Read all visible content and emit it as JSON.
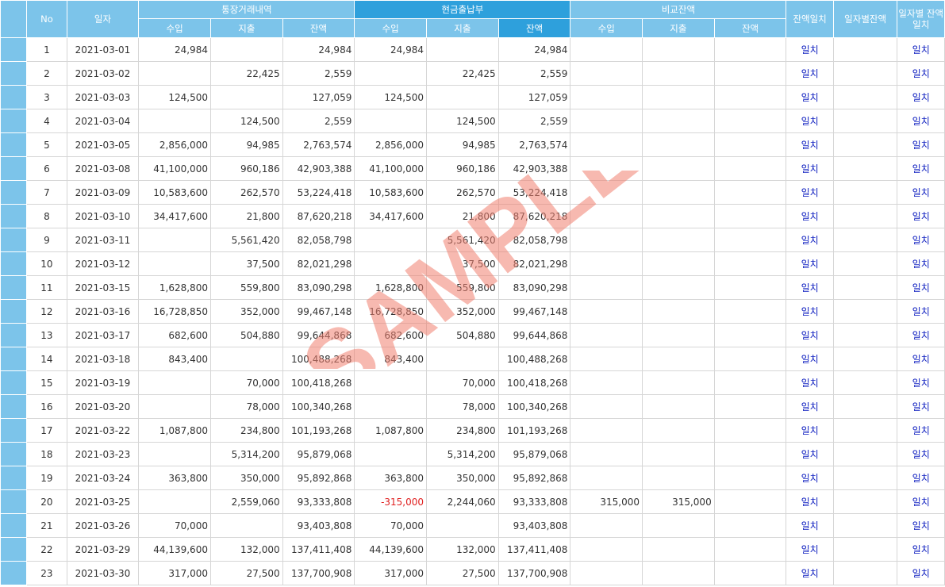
{
  "headers": {
    "no": "No",
    "date": "일자",
    "group_bank": "통장거래내역",
    "group_cash": "현금출납부",
    "group_diff": "비교잔액",
    "income": "수입",
    "expense": "지출",
    "balance": "잔액",
    "balance_match": "잔액일치",
    "daily_balance": "일자별잔액",
    "daily_match": "일자별 잔액일치"
  },
  "rows": [
    {
      "no": "1",
      "date": "2021-03-01",
      "b_in": "24,984",
      "b_out": "",
      "b_bal": "24,984",
      "c_in": "24,984",
      "c_out": "",
      "c_bal": "24,984",
      "d_in": "",
      "d_out": "",
      "d_bal": "",
      "match": "일치",
      "daily": "",
      "dmatch": "일치"
    },
    {
      "no": "2",
      "date": "2021-03-02",
      "b_in": "",
      "b_out": "22,425",
      "b_bal": "2,559",
      "c_in": "",
      "c_out": "22,425",
      "c_bal": "2,559",
      "d_in": "",
      "d_out": "",
      "d_bal": "",
      "match": "일치",
      "daily": "",
      "dmatch": "일치"
    },
    {
      "no": "3",
      "date": "2021-03-03",
      "b_in": "124,500",
      "b_out": "",
      "b_bal": "127,059",
      "c_in": "124,500",
      "c_out": "",
      "c_bal": "127,059",
      "d_in": "",
      "d_out": "",
      "d_bal": "",
      "match": "일치",
      "daily": "",
      "dmatch": "일치"
    },
    {
      "no": "4",
      "date": "2021-03-04",
      "b_in": "",
      "b_out": "124,500",
      "b_bal": "2,559",
      "c_in": "",
      "c_out": "124,500",
      "c_bal": "2,559",
      "d_in": "",
      "d_out": "",
      "d_bal": "",
      "match": "일치",
      "daily": "",
      "dmatch": "일치"
    },
    {
      "no": "5",
      "date": "2021-03-05",
      "b_in": "2,856,000",
      "b_out": "94,985",
      "b_bal": "2,763,574",
      "c_in": "2,856,000",
      "c_out": "94,985",
      "c_bal": "2,763,574",
      "d_in": "",
      "d_out": "",
      "d_bal": "",
      "match": "일치",
      "daily": "",
      "dmatch": "일치"
    },
    {
      "no": "6",
      "date": "2021-03-08",
      "b_in": "41,100,000",
      "b_out": "960,186",
      "b_bal": "42,903,388",
      "c_in": "41,100,000",
      "c_out": "960,186",
      "c_bal": "42,903,388",
      "d_in": "",
      "d_out": "",
      "d_bal": "",
      "match": "일치",
      "daily": "",
      "dmatch": "일치"
    },
    {
      "no": "7",
      "date": "2021-03-09",
      "b_in": "10,583,600",
      "b_out": "262,570",
      "b_bal": "53,224,418",
      "c_in": "10,583,600",
      "c_out": "262,570",
      "c_bal": "53,224,418",
      "d_in": "",
      "d_out": "",
      "d_bal": "",
      "match": "일치",
      "daily": "",
      "dmatch": "일치"
    },
    {
      "no": "8",
      "date": "2021-03-10",
      "b_in": "34,417,600",
      "b_out": "21,800",
      "b_bal": "87,620,218",
      "c_in": "34,417,600",
      "c_out": "21,800",
      "c_bal": "87,620,218",
      "d_in": "",
      "d_out": "",
      "d_bal": "",
      "match": "일치",
      "daily": "",
      "dmatch": "일치"
    },
    {
      "no": "9",
      "date": "2021-03-11",
      "b_in": "",
      "b_out": "5,561,420",
      "b_bal": "82,058,798",
      "c_in": "",
      "c_out": "5,561,420",
      "c_bal": "82,058,798",
      "d_in": "",
      "d_out": "",
      "d_bal": "",
      "match": "일치",
      "daily": "",
      "dmatch": "일치"
    },
    {
      "no": "10",
      "date": "2021-03-12",
      "b_in": "",
      "b_out": "37,500",
      "b_bal": "82,021,298",
      "c_in": "",
      "c_out": "37,500",
      "c_bal": "82,021,298",
      "d_in": "",
      "d_out": "",
      "d_bal": "",
      "match": "일치",
      "daily": "",
      "dmatch": "일치"
    },
    {
      "no": "11",
      "date": "2021-03-15",
      "b_in": "1,628,800",
      "b_out": "559,800",
      "b_bal": "83,090,298",
      "c_in": "1,628,800",
      "c_out": "559,800",
      "c_bal": "83,090,298",
      "d_in": "",
      "d_out": "",
      "d_bal": "",
      "match": "일치",
      "daily": "",
      "dmatch": "일치"
    },
    {
      "no": "12",
      "date": "2021-03-16",
      "b_in": "16,728,850",
      "b_out": "352,000",
      "b_bal": "99,467,148",
      "c_in": "16,728,850",
      "c_out": "352,000",
      "c_bal": "99,467,148",
      "d_in": "",
      "d_out": "",
      "d_bal": "",
      "match": "일치",
      "daily": "",
      "dmatch": "일치"
    },
    {
      "no": "13",
      "date": "2021-03-17",
      "b_in": "682,600",
      "b_out": "504,880",
      "b_bal": "99,644,868",
      "c_in": "682,600",
      "c_out": "504,880",
      "c_bal": "99,644,868",
      "d_in": "",
      "d_out": "",
      "d_bal": "",
      "match": "일치",
      "daily": "",
      "dmatch": "일치"
    },
    {
      "no": "14",
      "date": "2021-03-18",
      "b_in": "843,400",
      "b_out": "",
      "b_bal": "100,488,268",
      "c_in": "843,400",
      "c_out": "",
      "c_bal": "100,488,268",
      "d_in": "",
      "d_out": "",
      "d_bal": "",
      "match": "일치",
      "daily": "",
      "dmatch": "일치"
    },
    {
      "no": "15",
      "date": "2021-03-19",
      "b_in": "",
      "b_out": "70,000",
      "b_bal": "100,418,268",
      "c_in": "",
      "c_out": "70,000",
      "c_bal": "100,418,268",
      "d_in": "",
      "d_out": "",
      "d_bal": "",
      "match": "일치",
      "daily": "",
      "dmatch": "일치"
    },
    {
      "no": "16",
      "date": "2021-03-20",
      "b_in": "",
      "b_out": "78,000",
      "b_bal": "100,340,268",
      "c_in": "",
      "c_out": "78,000",
      "c_bal": "100,340,268",
      "d_in": "",
      "d_out": "",
      "d_bal": "",
      "match": "일치",
      "daily": "",
      "dmatch": "일치"
    },
    {
      "no": "17",
      "date": "2021-03-22",
      "b_in": "1,087,800",
      "b_out": "234,800",
      "b_bal": "101,193,268",
      "c_in": "1,087,800",
      "c_out": "234,800",
      "c_bal": "101,193,268",
      "d_in": "",
      "d_out": "",
      "d_bal": "",
      "match": "일치",
      "daily": "",
      "dmatch": "일치"
    },
    {
      "no": "18",
      "date": "2021-03-23",
      "b_in": "",
      "b_out": "5,314,200",
      "b_bal": "95,879,068",
      "c_in": "",
      "c_out": "5,314,200",
      "c_bal": "95,879,068",
      "d_in": "",
      "d_out": "",
      "d_bal": "",
      "match": "일치",
      "daily": "",
      "dmatch": "일치"
    },
    {
      "no": "19",
      "date": "2021-03-24",
      "b_in": "363,800",
      "b_out": "350,000",
      "b_bal": "95,892,868",
      "c_in": "363,800",
      "c_out": "350,000",
      "c_bal": "95,892,868",
      "d_in": "",
      "d_out": "",
      "d_bal": "",
      "match": "일치",
      "daily": "",
      "dmatch": "일치"
    },
    {
      "no": "20",
      "date": "2021-03-25",
      "b_in": "",
      "b_out": "2,559,060",
      "b_bal": "93,333,808",
      "c_in": "-315,000",
      "c_out": "2,244,060",
      "c_bal": "93,333,808",
      "d_in": "315,000",
      "d_out": "315,000",
      "d_bal": "",
      "match": "일치",
      "daily": "",
      "dmatch": "일치",
      "c_in_negative": true
    },
    {
      "no": "21",
      "date": "2021-03-26",
      "b_in": "70,000",
      "b_out": "",
      "b_bal": "93,403,808",
      "c_in": "70,000",
      "c_out": "",
      "c_bal": "93,403,808",
      "d_in": "",
      "d_out": "",
      "d_bal": "",
      "match": "일치",
      "daily": "",
      "dmatch": "일치"
    },
    {
      "no": "22",
      "date": "2021-03-29",
      "b_in": "44,139,600",
      "b_out": "132,000",
      "b_bal": "137,411,408",
      "c_in": "44,139,600",
      "c_out": "132,000",
      "c_bal": "137,411,408",
      "d_in": "",
      "d_out": "",
      "d_bal": "",
      "match": "일치",
      "daily": "",
      "dmatch": "일치"
    },
    {
      "no": "23",
      "date": "2021-03-30",
      "b_in": "317,000",
      "b_out": "27,500",
      "b_bal": "137,700,908",
      "c_in": "317,000",
      "c_out": "27,500",
      "c_bal": "137,700,908",
      "d_in": "",
      "d_out": "",
      "d_bal": "",
      "match": "일치",
      "daily": "",
      "dmatch": "일치"
    }
  ],
  "watermark": {
    "text": "SAMPLE",
    "color": "#f08070"
  },
  "colors": {
    "header": "#7cc4ea",
    "header_selected": "#2ea0dc",
    "match_text": "#1020c0",
    "negative_text": "#e02020"
  }
}
